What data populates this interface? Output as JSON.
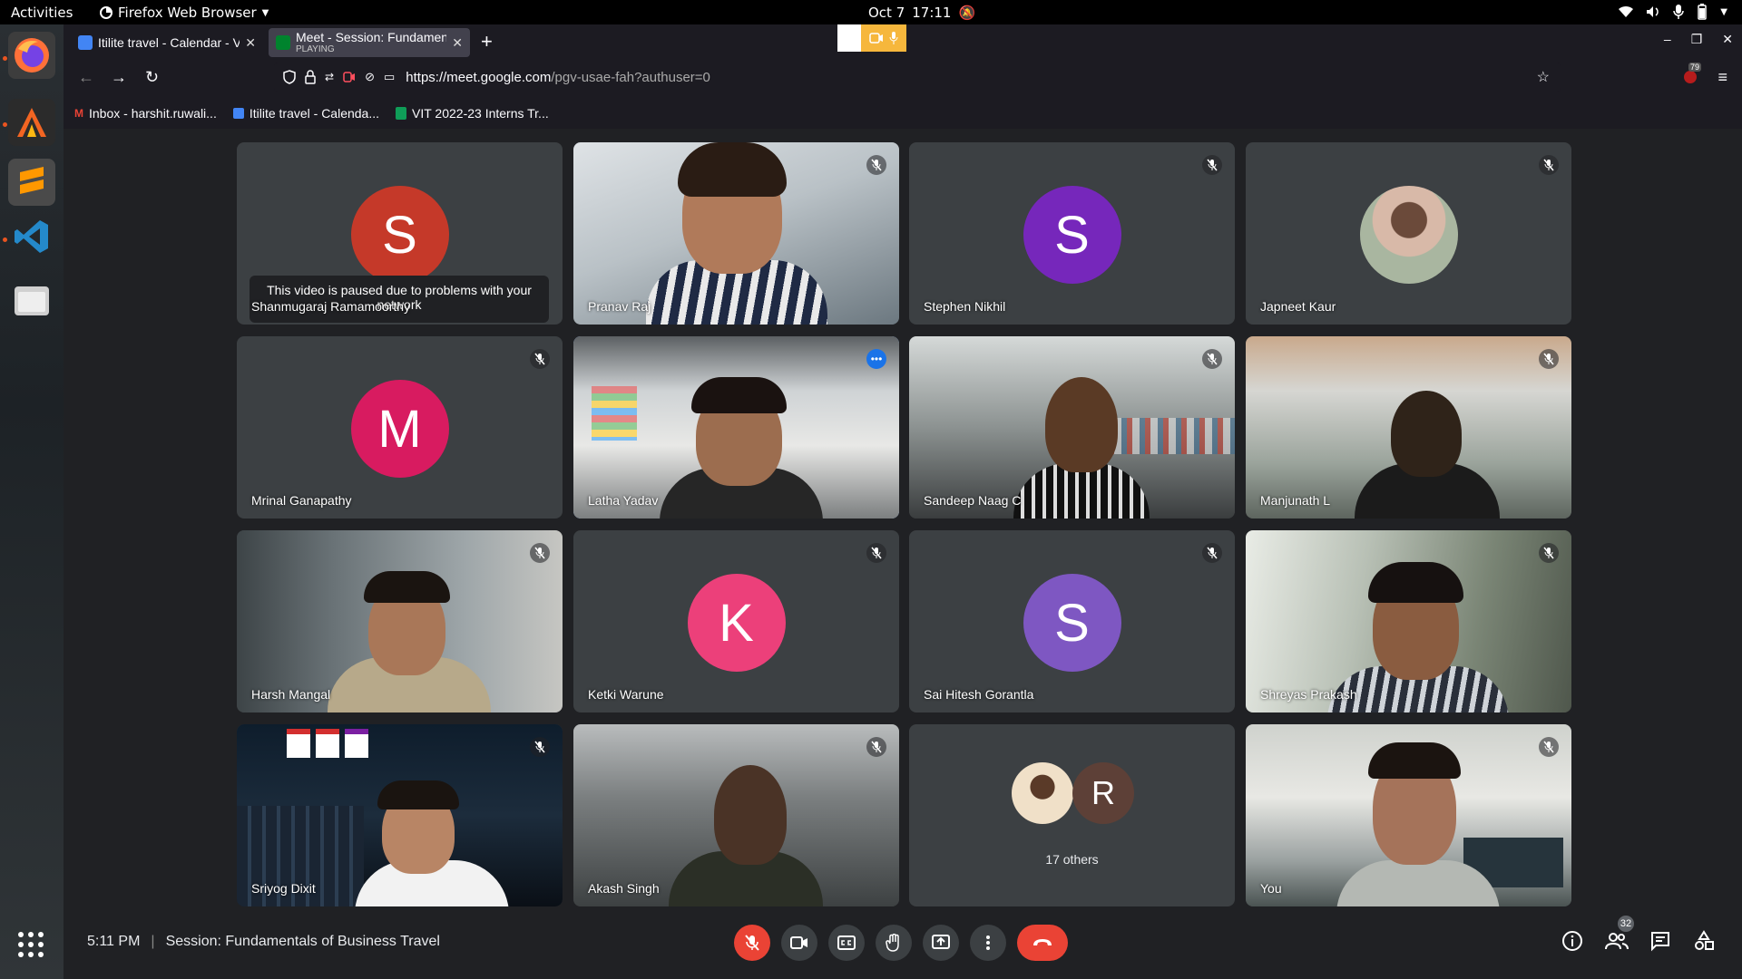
{
  "system": {
    "activities": "Activities",
    "app_name": "Firefox Web Browser",
    "date": "Oct 7",
    "time": "17:11"
  },
  "browser": {
    "tabs": [
      {
        "title": "Itilite travel - Calendar - V",
        "favicon_color": "#4285f4"
      },
      {
        "title": "Meet - Session: Fundamen",
        "subtitle": "PLAYING",
        "favicon_color": "#00832d"
      }
    ],
    "url_host": "https://meet.google.com",
    "url_path": "/pgv-usae-fah?authuser=0",
    "notification_count": "79",
    "bookmarks": [
      {
        "label": "Inbox - harshit.ruwali...",
        "icon": "gmail-icon"
      },
      {
        "label": "Itilite travel - Calenda...",
        "icon": "calendar-icon"
      },
      {
        "label": "VIT 2022-23 Interns Tr...",
        "icon": "sheets-icon"
      }
    ]
  },
  "meet": {
    "paused_message": "This video is paused due to problems with your network",
    "participants": [
      {
        "name": "Shanmugaraj Ramamoorthy",
        "initial": "S",
        "avatar_color": "#c53929",
        "type": "avatar",
        "paused": true
      },
      {
        "name": "Pranav Raj",
        "type": "video",
        "muted": true
      },
      {
        "name": "Stephen Nikhil",
        "initial": "S",
        "avatar_color": "#7627bb",
        "type": "avatar",
        "muted": true
      },
      {
        "name": "Japneet Kaur",
        "type": "photo",
        "muted": true
      },
      {
        "name": "Mrinal Ganapathy",
        "initial": "M",
        "avatar_color": "#d81b60",
        "type": "avatar",
        "muted": true
      },
      {
        "name": "Latha Yadav",
        "type": "video",
        "speaking": true
      },
      {
        "name": "Sandeep Naag C",
        "type": "video",
        "muted": true
      },
      {
        "name": "Manjunath L",
        "type": "video",
        "muted": true
      },
      {
        "name": "Harsh Mangal",
        "type": "video",
        "muted": true
      },
      {
        "name": "Ketki Warune",
        "initial": "K",
        "avatar_color": "#ec407a",
        "type": "avatar",
        "muted": true
      },
      {
        "name": "Sai Hitesh Gorantla",
        "initial": "S",
        "avatar_color": "#7e57c2",
        "type": "avatar",
        "muted": true
      },
      {
        "name": "Shreyas Prakash",
        "type": "video",
        "muted": true
      },
      {
        "name": "Sriyog Dixit",
        "type": "video",
        "muted": true
      },
      {
        "name": "Akash Singh",
        "type": "video",
        "muted": true
      },
      {
        "name": "You",
        "type": "video",
        "muted": true
      }
    ],
    "others": {
      "label": "17 others",
      "initial": "R",
      "avatar_color": "#5d4037"
    },
    "meeting_time": "5:11 PM",
    "meeting_title": "Session: Fundamentals of Business Travel",
    "people_count": "32"
  }
}
